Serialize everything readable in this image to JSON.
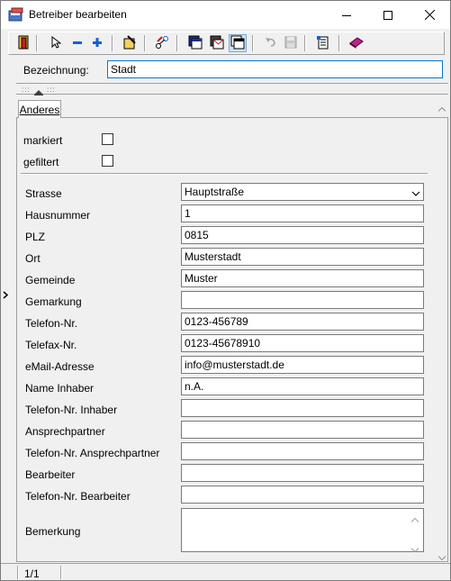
{
  "window": {
    "title": "Betreiber  bearbeiten"
  },
  "toolbar": {
    "buttons": [
      "exit-icon",
      "pointer-icon",
      "minus-icon",
      "plus-icon",
      "edit-icon",
      "link-icon",
      "window-icon",
      "mail-window-icon",
      "copy-window-icon",
      "undo-icon",
      "save-icon",
      "report-icon",
      "book-icon"
    ]
  },
  "header": {
    "label": "Bezeichnung:",
    "value": "Stadt"
  },
  "tabs": [
    {
      "label": "Anderes"
    }
  ],
  "checkboxes": [
    {
      "label": "markiert",
      "checked": false
    },
    {
      "label": "gefiltert",
      "checked": false
    }
  ],
  "fields": {
    "strasse": {
      "label": "Strasse",
      "value": "Hauptstraße"
    },
    "hausnummer": {
      "label": "Hausnummer",
      "value": "1"
    },
    "plz": {
      "label": "PLZ",
      "value": "0815"
    },
    "ort": {
      "label": "Ort",
      "value": "Musterstadt"
    },
    "gemeinde": {
      "label": "Gemeinde",
      "value": "Muster"
    },
    "gemarkung": {
      "label": "Gemarkung",
      "value": ""
    },
    "telefon": {
      "label": "Telefon-Nr.",
      "value": "0123-456789"
    },
    "telefax": {
      "label": "Telefax-Nr.",
      "value": "0123-45678910"
    },
    "email": {
      "label": "eMail-Adresse",
      "value": "info@musterstadt.de"
    },
    "inhaber": {
      "label": "Name Inhaber",
      "value": "n.A."
    },
    "tel_inhaber": {
      "label": "Telefon-Nr. Inhaber",
      "value": ""
    },
    "ansprechpartner": {
      "label": "Ansprechpartner",
      "value": ""
    },
    "tel_ansprechpartner": {
      "label": "Telefon-Nr. Ansprechpartner",
      "value": ""
    },
    "bearbeiter": {
      "label": "Bearbeiter",
      "value": ""
    },
    "tel_bearbeiter": {
      "label": "Telefon-Nr. Bearbeiter",
      "value": ""
    },
    "bemerkung": {
      "label": "Bemerkung",
      "value": ""
    }
  },
  "status": {
    "record": "1/1"
  },
  "colors": {
    "accent": "#0078d7",
    "border": "#7a7a7a",
    "background": "#f0f0f0"
  }
}
